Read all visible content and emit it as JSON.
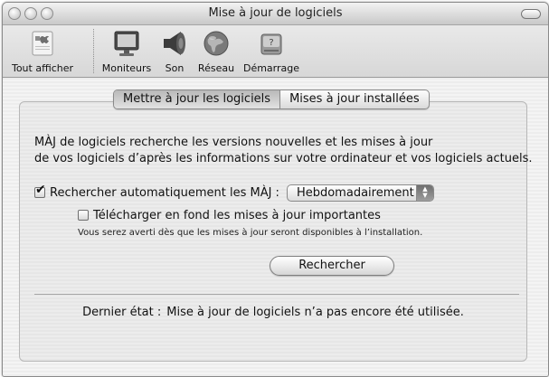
{
  "window": {
    "title": "Mise à jour de logiciels"
  },
  "toolbar": {
    "items": [
      {
        "label": "Tout afficher",
        "icon": "show-all-icon"
      },
      {
        "label": "Moniteurs",
        "icon": "monitor-icon"
      },
      {
        "label": "Son",
        "icon": "speaker-icon"
      },
      {
        "label": "Réseau",
        "icon": "network-globe-icon"
      },
      {
        "label": "Démarrage",
        "icon": "startup-disk-icon"
      }
    ]
  },
  "tabs": [
    {
      "label": "Mettre à jour les logiciels",
      "selected": true
    },
    {
      "label": "Mises à jour installées",
      "selected": false
    }
  ],
  "description": {
    "line1": "MÀJ de logiciels recherche les versions nouvelles et les mises à jour",
    "line2": "de vos logiciels d’après les informations sur votre ordinateur et vos logiciels actuels."
  },
  "auto_check": {
    "label": "Rechercher automatiquement les MÀJ :",
    "checked": true,
    "frequency": "Hebdomadairement"
  },
  "background_download": {
    "label": "Télécharger en fond les mises à jour importantes",
    "checked": false
  },
  "note": "Vous serez averti dès que les mises à jour seront disponibles à l’installation.",
  "check_button": "Rechercher",
  "status": {
    "label": "Dernier état :",
    "value": "Mise à jour de logiciels n’a pas encore été utilisée."
  },
  "colors": {
    "background": "#ececec",
    "accent": "#8a8a8a"
  }
}
